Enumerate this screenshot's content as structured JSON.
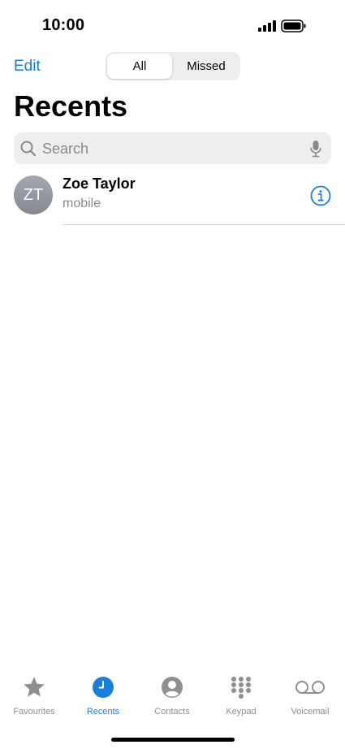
{
  "status_bar": {
    "time": "10:00"
  },
  "header": {
    "edit_label": "Edit",
    "segments": [
      {
        "label": "All",
        "selected": true
      },
      {
        "label": "Missed",
        "selected": false
      }
    ],
    "title": "Recents"
  },
  "search": {
    "placeholder": "Search",
    "value": ""
  },
  "recents": [
    {
      "initials": "ZT",
      "name": "Zoe Taylor",
      "type": "mobile"
    }
  ],
  "tab_bar": {
    "items": [
      {
        "label": "Favourites",
        "icon": "star-icon",
        "active": false
      },
      {
        "label": "Recents",
        "icon": "clock-icon",
        "active": true
      },
      {
        "label": "Contacts",
        "icon": "person-circle-icon",
        "active": false
      },
      {
        "label": "Keypad",
        "icon": "keypad-icon",
        "active": false
      },
      {
        "label": "Voicemail",
        "icon": "voicemail-icon",
        "active": false
      }
    ]
  },
  "colors": {
    "accent": "#1a7fd8",
    "inactive": "#8e8e93",
    "search_bg": "#eeeeef"
  }
}
